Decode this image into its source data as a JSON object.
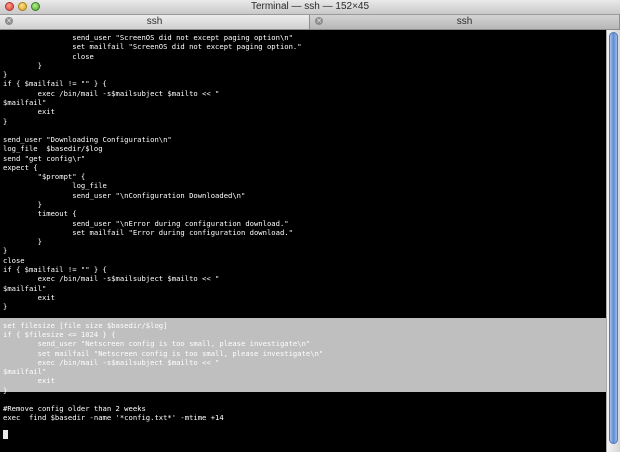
{
  "window": {
    "title": "Terminal — ssh — 152×45"
  },
  "tabs": [
    {
      "label": "ssh",
      "active": true
    },
    {
      "label": "ssh",
      "active": false
    }
  ],
  "terminal": {
    "lines": [
      "                send_user \"ScreenOS did not except paging option\\n\"",
      "                set mailfail \"ScreenOS did not except paging option.\"",
      "                close",
      "        }",
      "}",
      "if { $mailfail != \"\" } {",
      "        exec /bin/mail -s$mailsubject $mailto << \"",
      "$mailfail\"",
      "        exit",
      "}",
      "",
      "send_user \"Downloading Configuration\\n\"",
      "log_file  $basedir/$log",
      "send \"get config\\r\"",
      "expect {",
      "        \"$prompt\" {",
      "                log_file",
      "                send_user \"\\nConfiguration Downloaded\\n\"",
      "        }",
      "        timeout {",
      "                send_user \"\\nError during configuration download.\"",
      "                set mailfail \"Error during configuration download.\"",
      "        }",
      "}",
      "close",
      "if { $mailfail != \"\" } {",
      "        exec /bin/mail -s$mailsubject $mailto << \"",
      "$mailfail\"",
      "        exit",
      "}",
      "",
      "set filesize [file size $basedir/$log]",
      "if { $filesize <= 1024 } {",
      "        send_user \"Netscreen config is too small, please investigate\\n\"",
      "        set mailfail \"Netscreen config is too small, please investigate\\n\"",
      "        exec /bin/mail -s$mailsubject $mailto << \"",
      "$mailfail\"",
      "        exit",
      "}",
      "",
      "#Remove config older than 2 weeks",
      "exec  find $basedir -name '*config.txt*' -mtime +14"
    ],
    "selected_line_range": [
      31,
      38
    ],
    "colors": {
      "background": "#000000",
      "foreground": "#ffffff",
      "selection": "#bfbfbf"
    }
  }
}
